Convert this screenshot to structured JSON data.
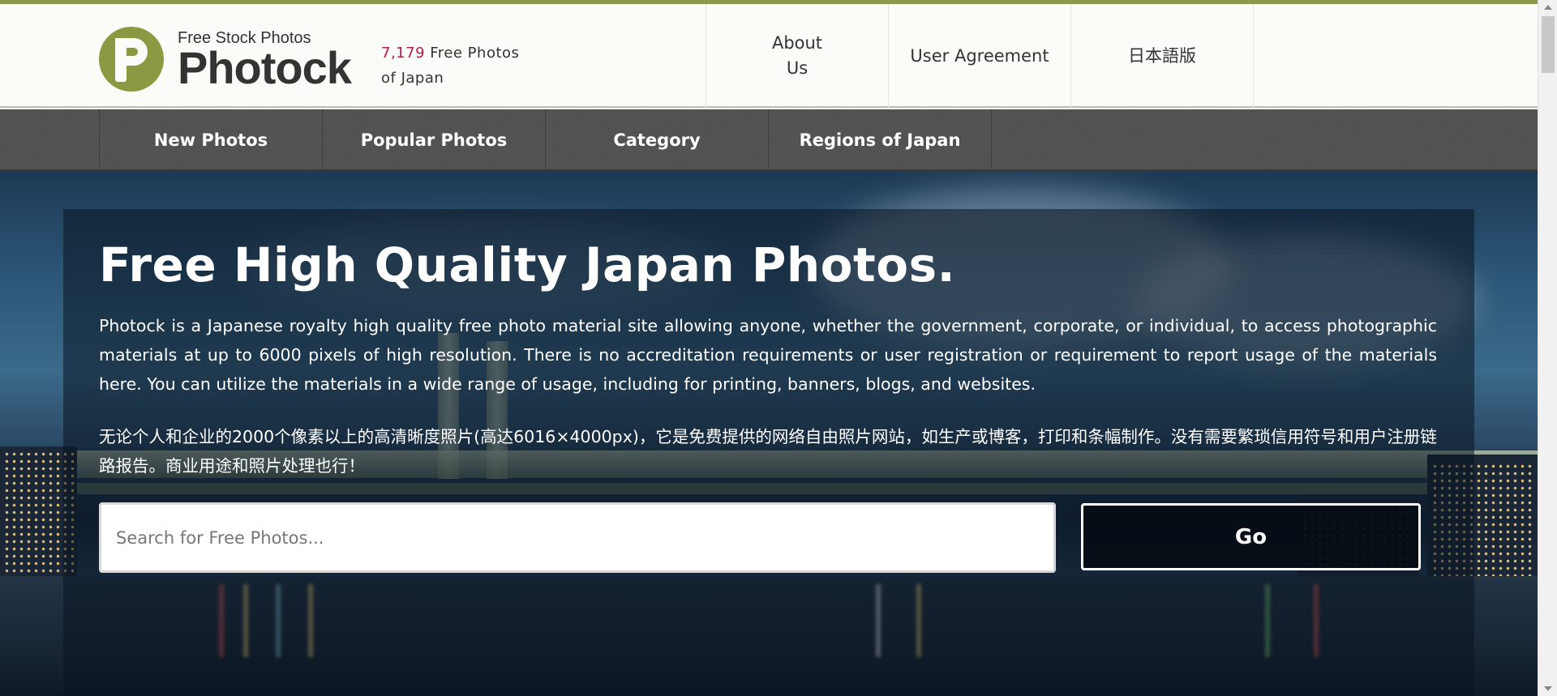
{
  "header": {
    "logo_small": "Free Stock Photos",
    "logo_big": "Photock",
    "count_number": "7,179",
    "count_text_1": "Free Photos",
    "count_text_2": "of Japan",
    "nav": [
      {
        "label_1": "About",
        "label_2": "Us"
      },
      {
        "label": "User Agreement"
      },
      {
        "label": "日本語版"
      }
    ]
  },
  "mainnav": {
    "items": [
      "New Photos",
      "Popular Photos",
      "Category",
      "Regions of Japan"
    ]
  },
  "hero": {
    "title": "Free High Quality Japan Photos.",
    "desc_en": "Photock is a Japanese royalty high quality free photo material site allowing anyone, whether the government, corporate, or individual, to access photographic materials at up to 6000 pixels of high resolution. There is no accreditation requirements or user registration or requirement to report usage of the materials here. You can utilize the materials in a wide range of usage, including for printing, banners, blogs, and websites.",
    "desc_zh": "无论个人和企业的2000个像素以上的高清晰度照片(高达6016×4000px)，它是免费提供的网络自由照片网站，如生产或博客，打印和条幅制作。没有需要繁琐信用符号和用户注册链路报告。商业用途和照片处理也行！",
    "search_placeholder": "Search for Free Photos...",
    "go_label": "Go"
  },
  "colors": {
    "accent": "#8a9a42",
    "count_number": "#b0204a",
    "nav_bg": "#525252"
  }
}
